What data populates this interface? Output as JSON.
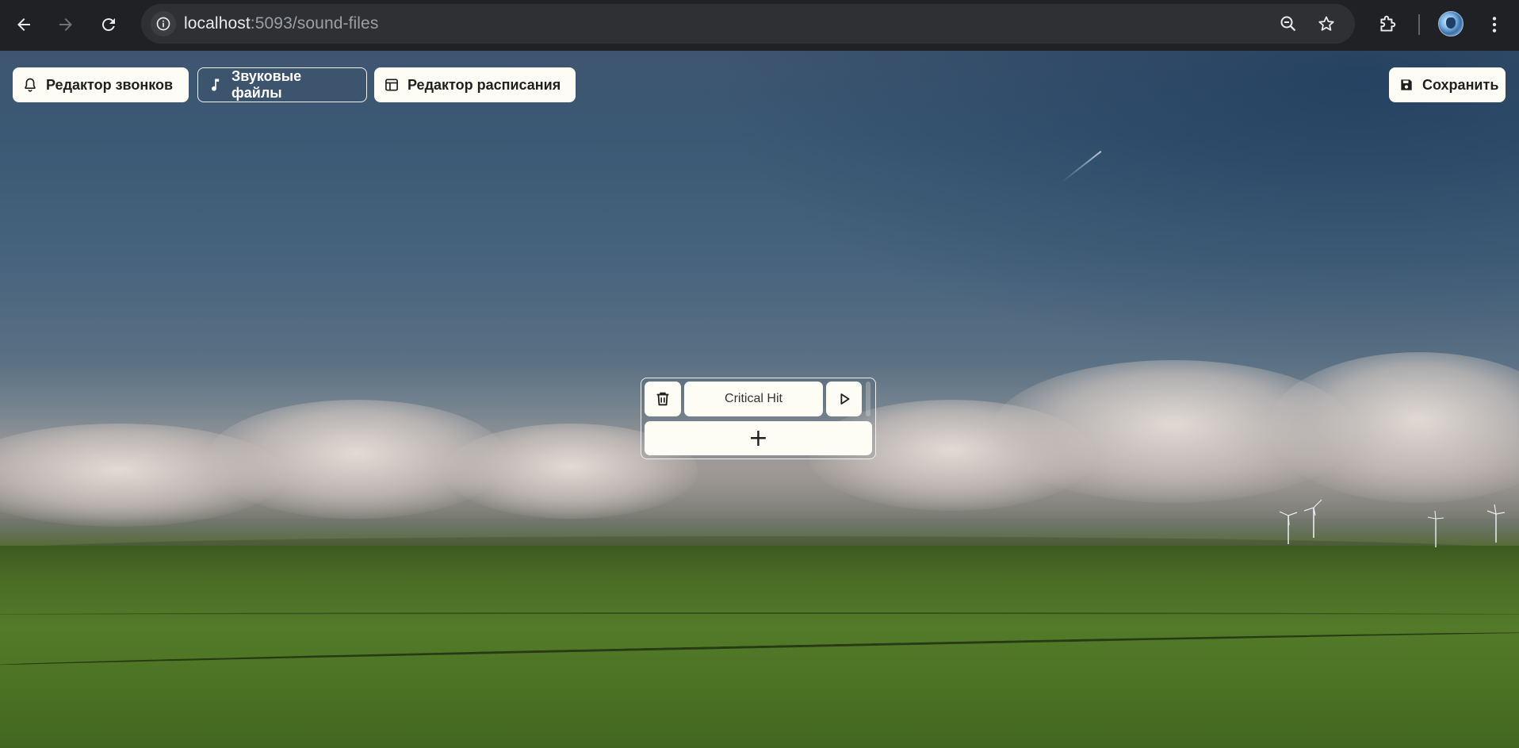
{
  "browser": {
    "url_host": "localhost",
    "url_path": ":5093/sound-files",
    "icons": {
      "back": "arrow-left-icon",
      "forward": "arrow-right-icon",
      "reload": "reload-icon",
      "site_info": "info-icon",
      "zoom": "zoom-out-icon",
      "bookmark": "star-icon",
      "extensions": "puzzle-icon",
      "profile": "avatar",
      "menu": "kebab-menu-icon"
    },
    "colors": {
      "frame": "#202124",
      "omnibox": "#2f3034"
    }
  },
  "toolbar": {
    "bells_editor": "Редактор звонков",
    "sound_files": "Звуковые файлы",
    "schedule_editor": "Редактор расписания",
    "save": "Сохранить",
    "active_tab": "sound_files"
  },
  "sound_files": {
    "items": [
      {
        "name": "Critical Hit"
      }
    ],
    "add_label": "+"
  },
  "colors": {
    "button_bg": "#fefdf5",
    "button_text": "#1f1f1f",
    "active_border": "#f2f2f2"
  }
}
